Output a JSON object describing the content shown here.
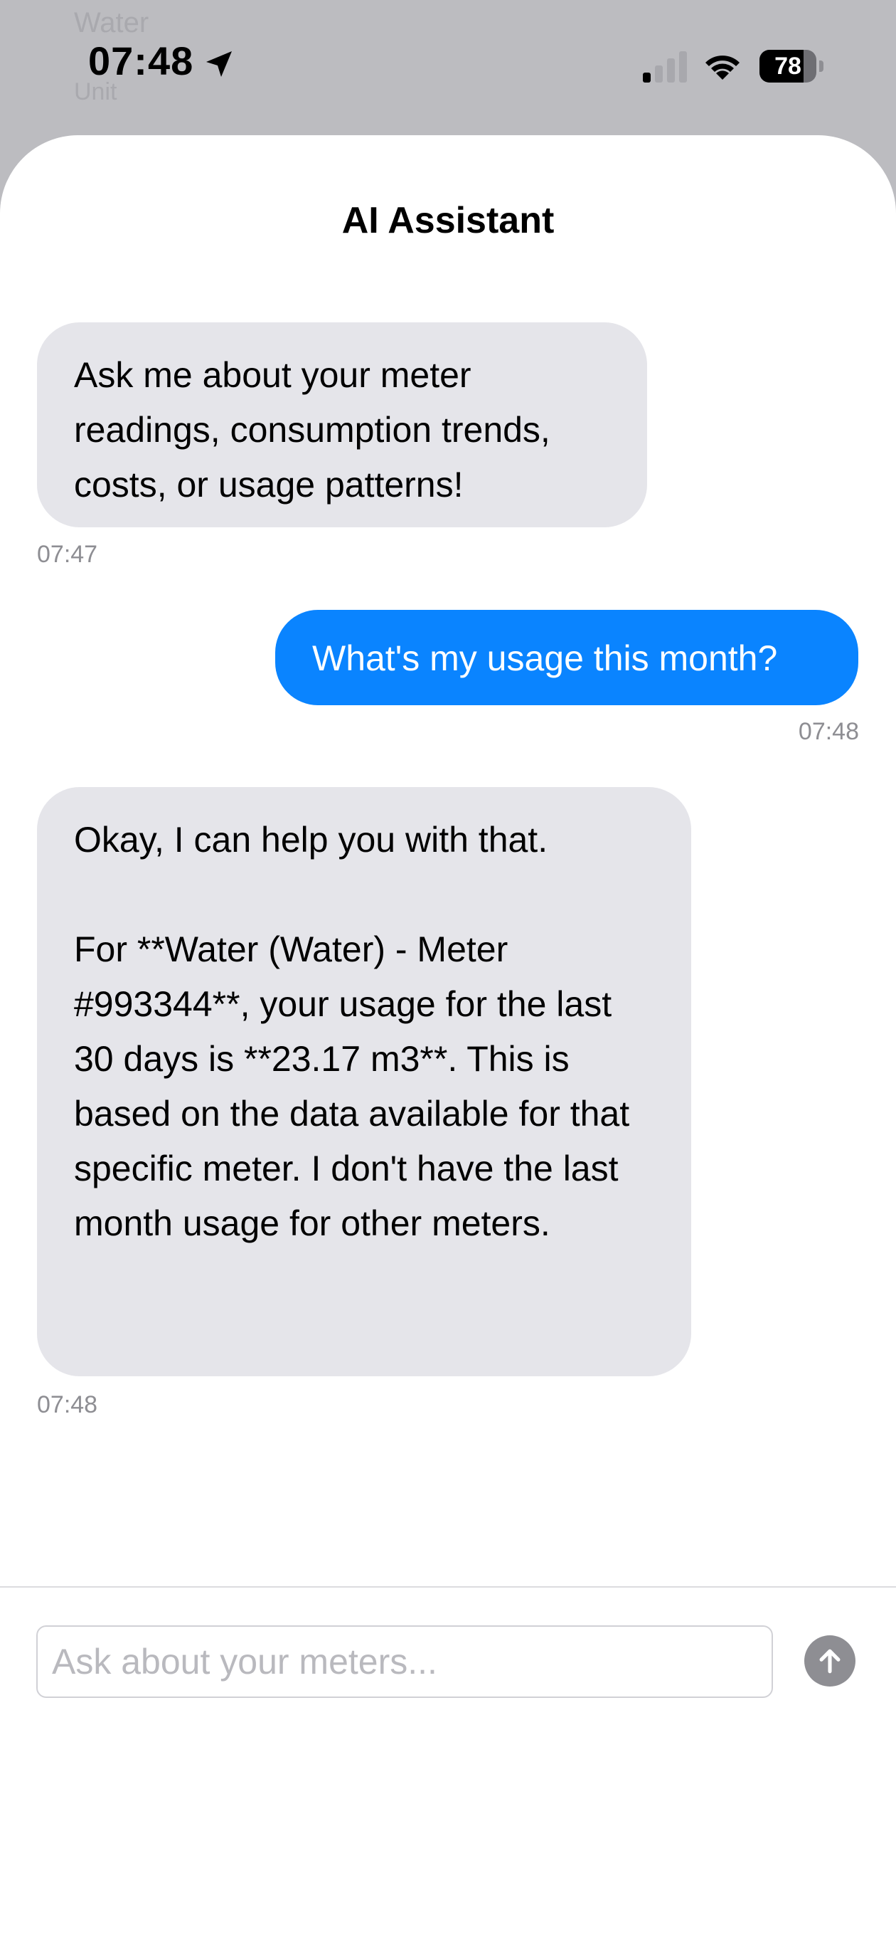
{
  "background_app": {
    "peek_text": "Water",
    "peek_text_2": "Unit"
  },
  "status_bar": {
    "time": "07:48",
    "battery_percent": "78",
    "battery_level": 0.78,
    "signal_bars_active": 1,
    "icons": [
      "location-arrow-icon",
      "cellular-signal-icon",
      "wifi-icon",
      "battery-icon"
    ]
  },
  "sheet": {
    "title": "AI Assistant"
  },
  "messages": [
    {
      "role": "assistant",
      "text": "Ask me about your meter readings, consumption trends, costs, or usage patterns!",
      "time": "07:47"
    },
    {
      "role": "user",
      "text": "What's my usage this month?",
      "time": "07:48"
    },
    {
      "role": "assistant",
      "text": "Okay, I can help you with that.\n\nFor **Water (Water) - Meter #993344**, your usage for the last 30 days is **23.17 m3**. This is based on the data available for that specific meter. I don't have the last month usage for other meters.\n",
      "time": "07:48"
    }
  ],
  "input": {
    "placeholder": "Ask about your meters...",
    "value": ""
  },
  "send_button": {
    "icon": "arrow-up-icon"
  },
  "colors": {
    "assistant_bubble": "#e5e5ea",
    "user_bubble": "#0a84ff",
    "timestamp": "#8e8e93",
    "send_button": "#8e8e93"
  }
}
